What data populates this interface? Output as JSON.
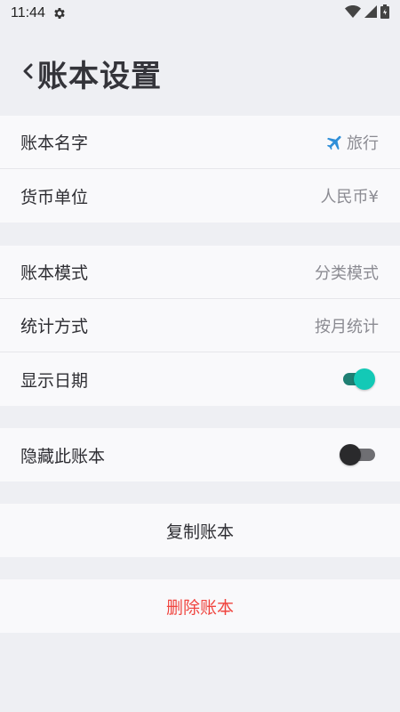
{
  "status_bar": {
    "time": "11:44"
  },
  "header": {
    "title": "账本设置"
  },
  "group1": {
    "name": {
      "label": "账本名字",
      "value": "旅行"
    },
    "currency": {
      "label": "货币单位",
      "value": "人民币¥"
    }
  },
  "group2": {
    "mode": {
      "label": "账本模式",
      "value": "分类模式"
    },
    "stats": {
      "label": "统计方式",
      "value": "按月统计"
    },
    "show_date": {
      "label": "显示日期",
      "on": true
    }
  },
  "group3": {
    "hide": {
      "label": "隐藏此账本",
      "on": false
    }
  },
  "actions": {
    "copy_label": "复制账本",
    "delete_label": "删除账本"
  },
  "colors": {
    "accent": "#13c9b6",
    "danger": "#f0453f",
    "background": "#eeeff3"
  }
}
